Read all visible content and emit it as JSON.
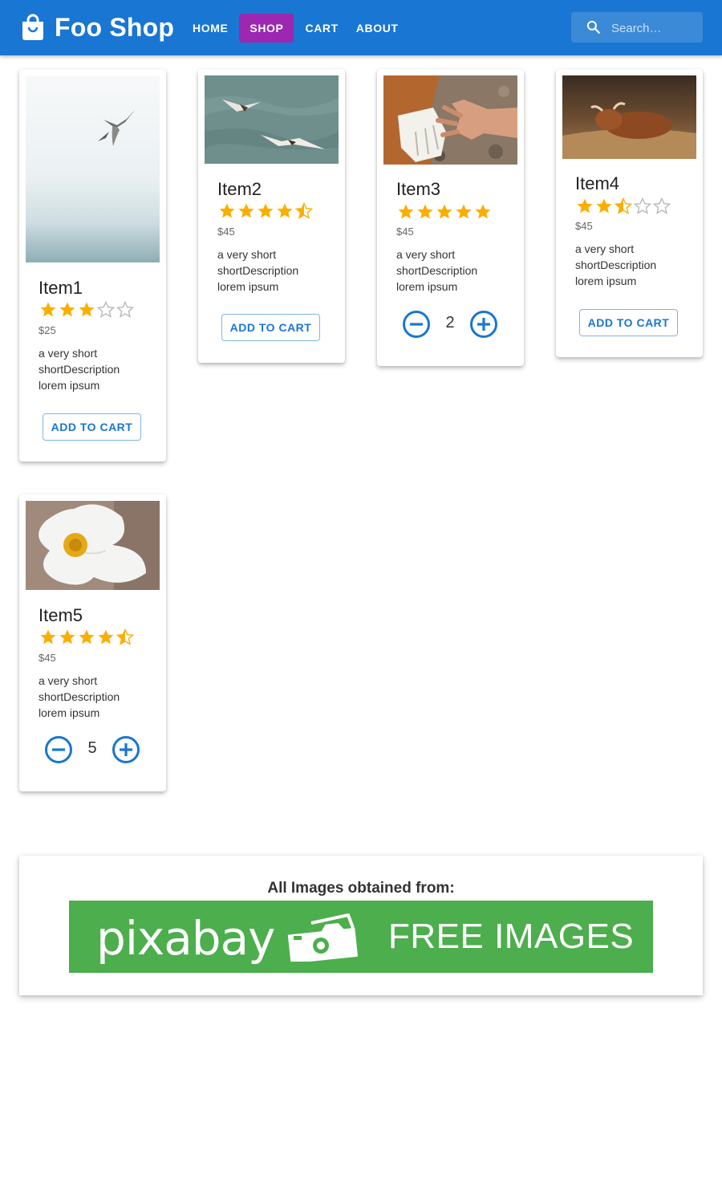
{
  "app": {
    "title": "Foo Shop",
    "brand_icon": "shopping-bag-icon",
    "brand_color": "#1976d2",
    "active_color": "#9c27b0"
  },
  "nav": {
    "home": "HOME",
    "shop": "SHOP",
    "cart": "CART",
    "about": "ABOUT",
    "active": "SHOP"
  },
  "search": {
    "placeholder": "Search…",
    "value": "",
    "icon": "search-icon"
  },
  "products": [
    {
      "name": "Item1",
      "rating": 3,
      "price": "$25",
      "description": "a very short shortDescription lorem ipsum",
      "action": "add",
      "add_label": "ADD TO CART"
    },
    {
      "name": "Item2",
      "rating": 4.5,
      "price": "$45",
      "description": "a very short shortDescription lorem ipsum",
      "action": "add",
      "add_label": "ADD TO CART"
    },
    {
      "name": "Item3",
      "rating": 5,
      "price": "$45",
      "description": "a very short shortDescription lorem ipsum",
      "action": "quantity",
      "quantity": "2"
    },
    {
      "name": "Item4",
      "rating": 2.5,
      "price": "$45",
      "description": "a very short shortDescription lorem ipsum",
      "action": "add",
      "add_label": "ADD TO CART"
    },
    {
      "name": "Item5",
      "rating": 4.5,
      "price": "$45",
      "description": "a very short shortDescription lorem ipsum",
      "action": "quantity",
      "quantity": "5"
    }
  ],
  "footer": {
    "title": "All Images obtained from:",
    "banner_logo": "pixabay",
    "banner_text": "FREE IMAGES",
    "banner_color": "#4cae4c"
  }
}
